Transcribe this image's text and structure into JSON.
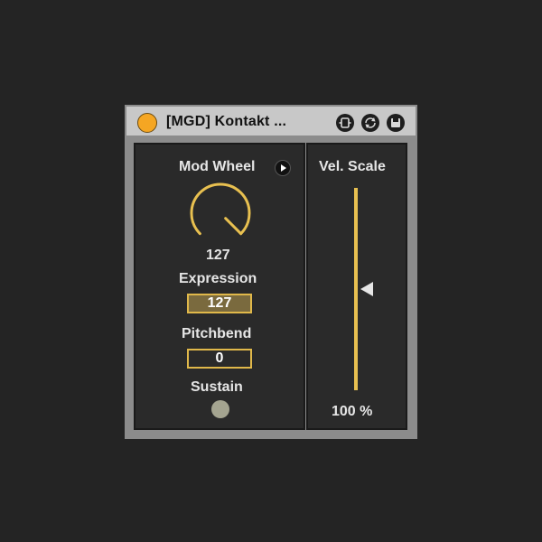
{
  "device": {
    "title": "[MGD] Kontakt ...",
    "power_color": "#f5a623",
    "icons": [
      "midi-map-icon",
      "refresh-icon",
      "save-icon"
    ]
  },
  "mod_wheel": {
    "label": "Mod Wheel",
    "value": "127",
    "knob_fraction": 1.0,
    "accent": "#e8c050"
  },
  "expression": {
    "label": "Expression",
    "value": "127"
  },
  "pitchbend": {
    "label": "Pitchbend",
    "value": "0"
  },
  "sustain": {
    "label": "Sustain"
  },
  "vel_scale": {
    "label": "Vel. Scale",
    "value": "100 %",
    "fraction": 0.5
  }
}
